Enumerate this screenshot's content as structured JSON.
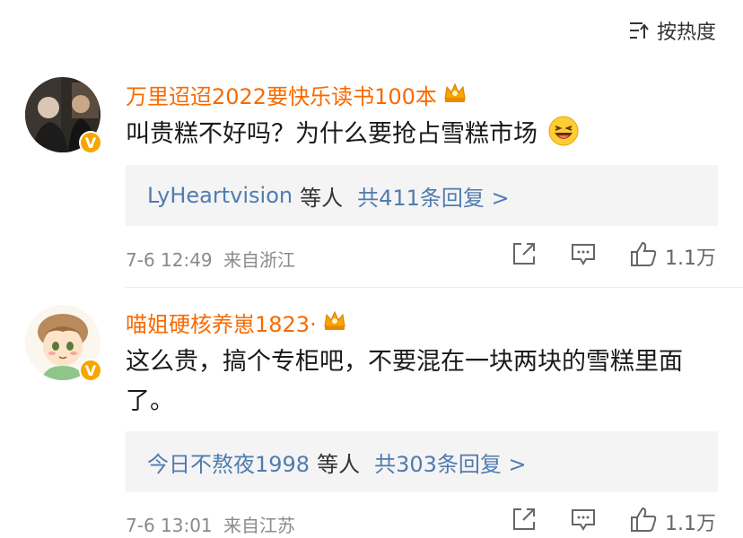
{
  "sort": {
    "label": "按热度"
  },
  "comments": [
    {
      "username": "万里迢迢2022要快乐读书100本",
      "text": "叫贵糕不好吗？为什么要抢占雪糕市场",
      "reply_users": "LyHeartvision",
      "reply_etc": "等人",
      "reply_count": "共411条回复 >",
      "time": "7-6 12:49",
      "location": "来自浙江",
      "likes": "1.1万",
      "verified_badge": "V"
    },
    {
      "username": "喵姐硬核养崽1823·",
      "text": "这么贵，搞个专柜吧，不要混在一块两块的雪糕里面了。",
      "reply_users": "今日不熬夜1998",
      "reply_etc": "等人",
      "reply_count": "共303条回复 >",
      "time": "7-6 13:01",
      "location": "来自江苏",
      "likes": "1.1万",
      "verified_badge": "V"
    }
  ],
  "colors": {
    "username": "#f86a00",
    "reply_link": "#4f7cb0",
    "meta": "#8a8a8a",
    "badge": "#f7a600"
  }
}
